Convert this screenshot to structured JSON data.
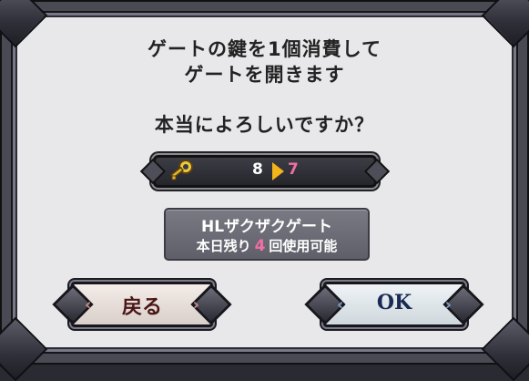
{
  "dialog": {
    "message_line1": "ゲートの鍵を1個消費して",
    "message_line2": "ゲートを開きます",
    "confirm_question": "本当によろしいですか？"
  },
  "keys": {
    "icon": "key-icon",
    "current": "8",
    "after": "7",
    "arrow_color": "#f3b31a",
    "after_color": "#f16fa2"
  },
  "gate": {
    "name": "HLザクザクゲート",
    "remaining_prefix": "本日残り",
    "remaining_count": "4",
    "remaining_suffix": "回使用可能"
  },
  "buttons": {
    "back_label": "戻る",
    "ok_label": "OK"
  }
}
